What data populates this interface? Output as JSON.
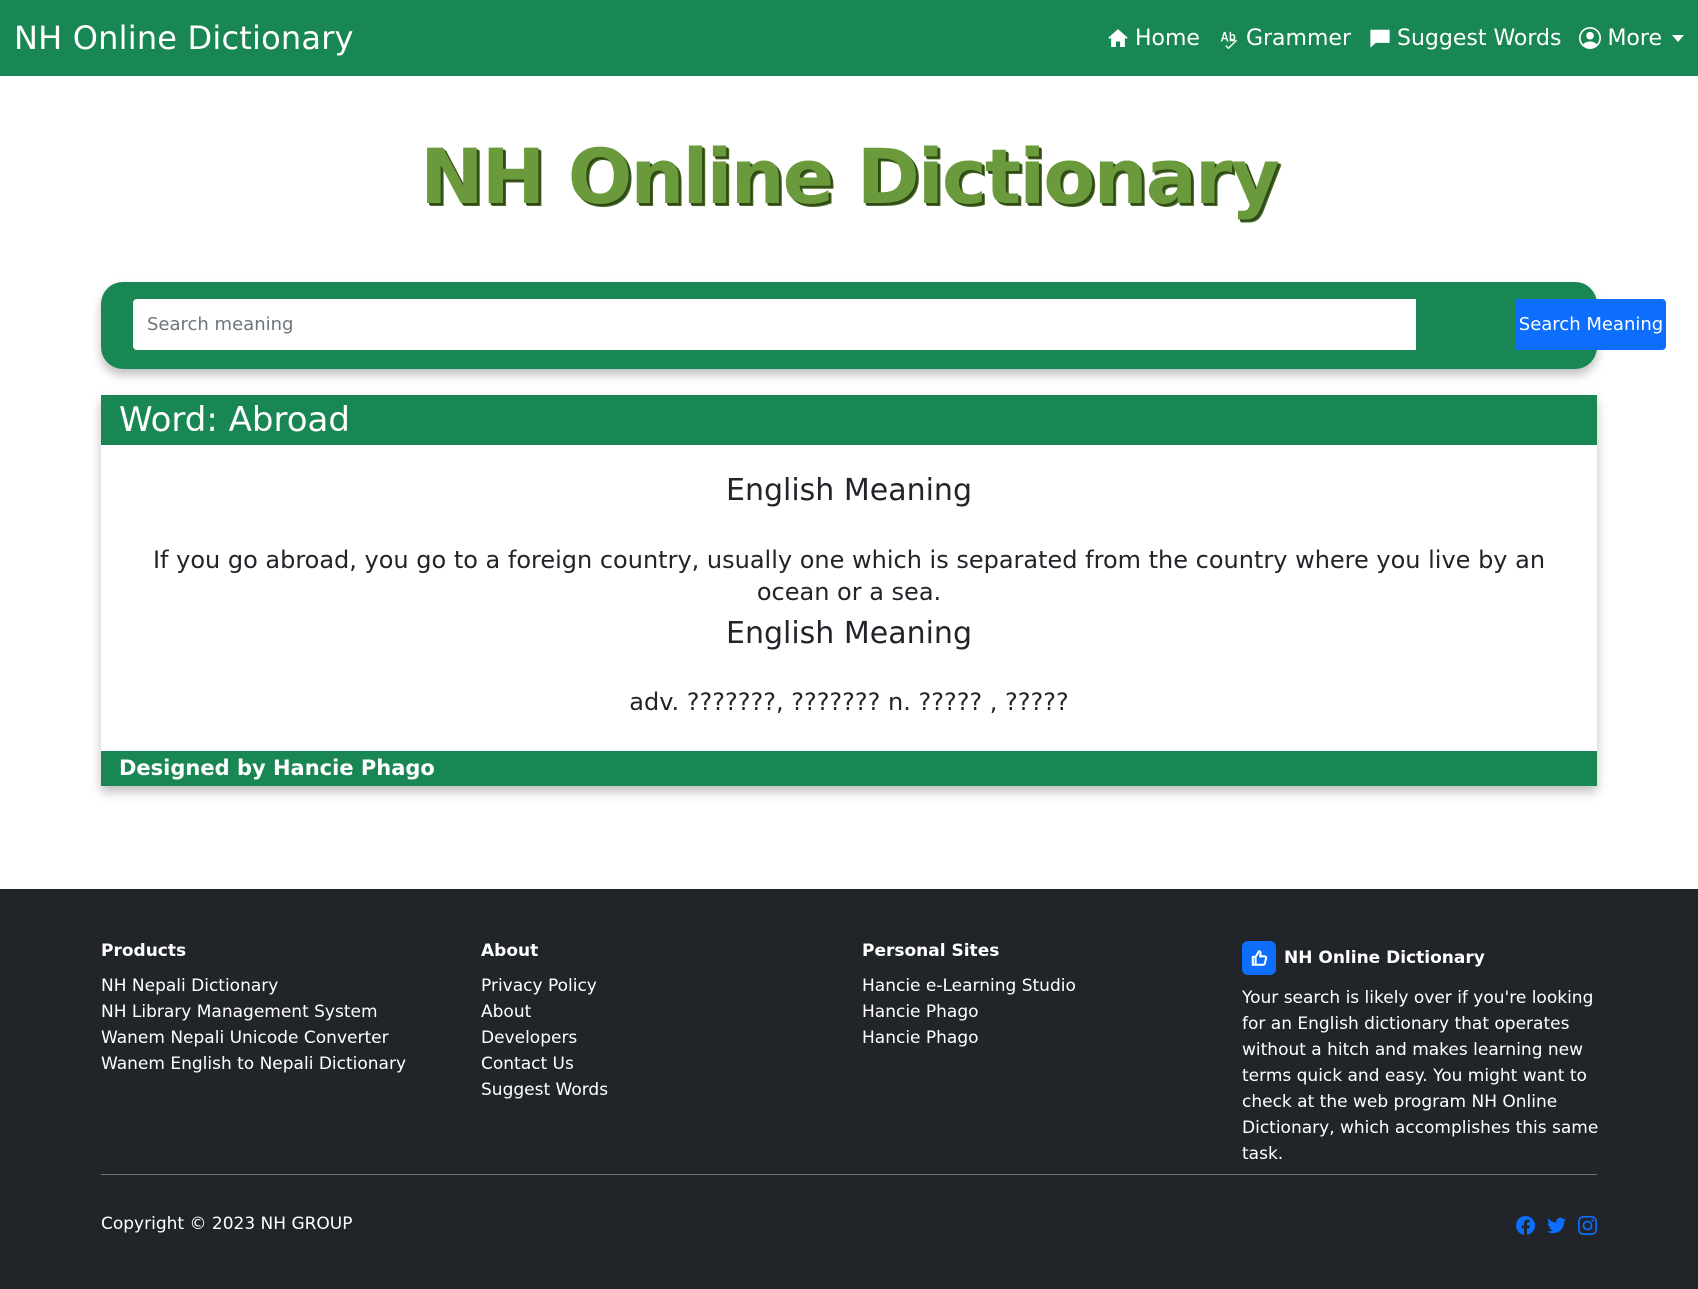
{
  "navbar": {
    "brand": "NH Online Dictionary",
    "links": [
      {
        "label": "Home",
        "icon": "home-icon"
      },
      {
        "label": "Grammer",
        "icon": "spellcheck-icon"
      },
      {
        "label": "Suggest Words",
        "icon": "chat-icon"
      },
      {
        "label": "More",
        "icon": "user-circle-icon"
      }
    ]
  },
  "hero": {
    "title": "NH Online Dictionary"
  },
  "search": {
    "placeholder": "Search meaning",
    "button_label": "Search Meaning"
  },
  "word_card": {
    "header": "Word: Abroad",
    "sections": [
      {
        "title": "English Meaning",
        "text": "If you go abroad, you go to a foreign country, usually one which is separated from the country where you live by an ocean or a sea."
      },
      {
        "title": "English Meaning",
        "text": "adv. ???????, ??????? n. ????? , ?????"
      }
    ],
    "footer": "Designed by Hancie Phago"
  },
  "footer": {
    "columns": [
      {
        "heading": "Products",
        "items": [
          "NH Nepali Dictionary",
          "NH Library Management System",
          "Wanem Nepali Unicode Converter",
          "Wanem English to Nepali Dictionary"
        ]
      },
      {
        "heading": "About",
        "items": [
          "Privacy Policy",
          "About",
          "Developers",
          "Contact Us",
          "Suggest Words"
        ]
      },
      {
        "heading": "Personal Sites",
        "items": [
          "Hancie e-Learning Studio",
          "Hancie Phago",
          "Hancie Phago"
        ]
      }
    ],
    "about": {
      "brand": "NH Online Dictionary",
      "text": "Your search is likely over if you're looking for an English dictionary that operates without a hitch and makes learning new terms quick and easy. You might want to check at the web program NH Online Dictionary, which accomplishes this same task."
    },
    "copyright": "Copyright © 2023 NH GROUP",
    "socials": [
      "facebook-icon",
      "twitter-icon",
      "instagram-icon"
    ]
  },
  "colors": {
    "primary_green": "#198754",
    "button_blue": "#0d6efd",
    "footer_dark": "#212529",
    "hero_green": "#6b9a3c"
  }
}
